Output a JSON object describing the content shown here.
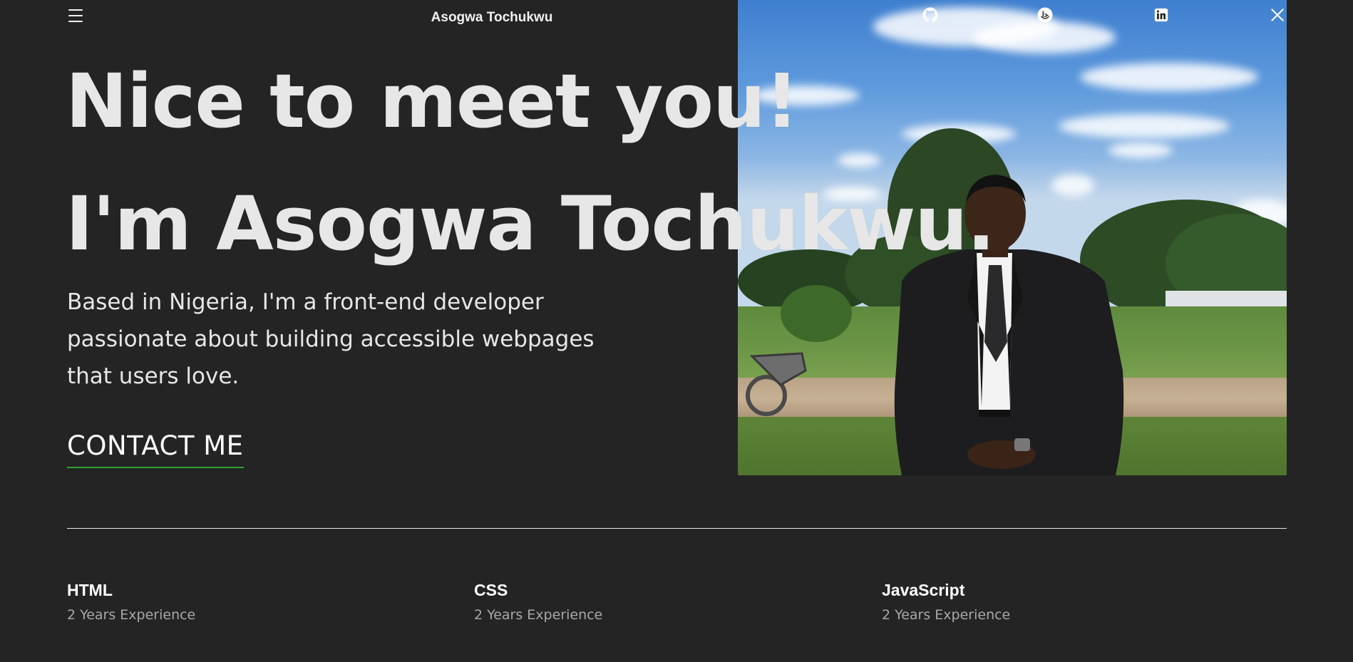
{
  "header": {
    "brand": "Asogwa Tochukwu",
    "menu_icon": "hamburger-menu-icon",
    "social_links": [
      {
        "name": "github",
        "icon": "github-icon"
      },
      {
        "name": "frontend-mentor",
        "icon": "frontend-mentor-icon"
      },
      {
        "name": "linkedin",
        "icon": "linkedin-icon"
      },
      {
        "name": "x-twitter",
        "icon": "x-icon"
      }
    ]
  },
  "hero": {
    "greeting": "Nice to meet you!",
    "name_line": "I'm Asogwa Tochukwu.",
    "intro": "Based in Nigeria, I'm a front-end developer passionate about building accessible webpages that users love.",
    "cta": "CONTACT ME",
    "cta_underline_color": "#2fa02f"
  },
  "skills": [
    {
      "name": "HTML",
      "experience": "2 Years Experience"
    },
    {
      "name": "CSS",
      "experience": "2 Years Experience"
    },
    {
      "name": "JavaScript",
      "experience": "2 Years Experience"
    }
  ],
  "colors": {
    "background": "#242424",
    "heading": "#e7e7e7",
    "muted": "#a8a8a8",
    "accent": "#2fa02f"
  }
}
